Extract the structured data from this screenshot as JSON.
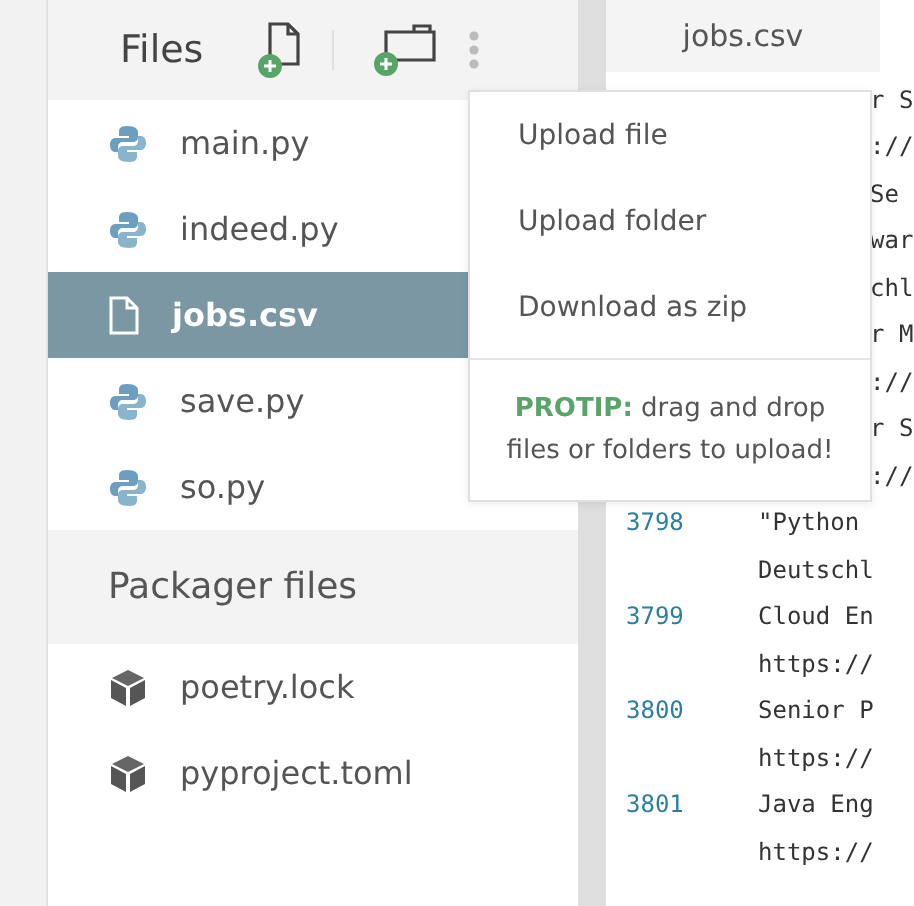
{
  "sidebar": {
    "title": "Files",
    "files": [
      {
        "name": "main.py",
        "kind": "python",
        "selected": false
      },
      {
        "name": "indeed.py",
        "kind": "python",
        "selected": false
      },
      {
        "name": "jobs.csv",
        "kind": "file",
        "selected": true
      },
      {
        "name": "save.py",
        "kind": "python",
        "selected": false
      },
      {
        "name": "so.py",
        "kind": "python",
        "selected": false
      }
    ],
    "packager": {
      "title": "Packager files",
      "files": [
        {
          "name": "poetry.lock",
          "kind": "package",
          "selected": false
        },
        {
          "name": "pyproject.toml",
          "kind": "package",
          "selected": false
        }
      ]
    }
  },
  "menu": {
    "items": [
      "Upload file",
      "Upload folder",
      "Download as zip"
    ],
    "protip_label": "PROTIP:",
    "protip": "drag and drop files or folders to upload!"
  },
  "editor": {
    "tab": "jobs.csv",
    "lines": [
      {
        "kind": "covered",
        "text": "r S"
      },
      {
        "kind": "covered",
        "text": "://"
      },
      {
        "kind": "covered",
        "text": "Se"
      },
      {
        "kind": "covered",
        "text": "war"
      },
      {
        "kind": "covered",
        "text": "chl"
      },
      {
        "kind": "covered",
        "text": "r M"
      },
      {
        "kind": "covered",
        "text": "://"
      },
      {
        "kind": "covered",
        "text": "r S"
      },
      {
        "kind": "covered",
        "text": "://"
      },
      {
        "kind": "line",
        "number": "3798",
        "text": "\"Python"
      },
      {
        "kind": "line",
        "text": "Deutschl"
      },
      {
        "kind": "line",
        "number": "3799",
        "text": "Cloud En"
      },
      {
        "kind": "line",
        "text": "https://"
      },
      {
        "kind": "line",
        "number": "3800",
        "text": "Senior P"
      },
      {
        "kind": "line",
        "text": "https://"
      },
      {
        "kind": "line",
        "number": "3801",
        "text": "Java Eng"
      },
      {
        "kind": "line",
        "text": "https://"
      }
    ]
  }
}
